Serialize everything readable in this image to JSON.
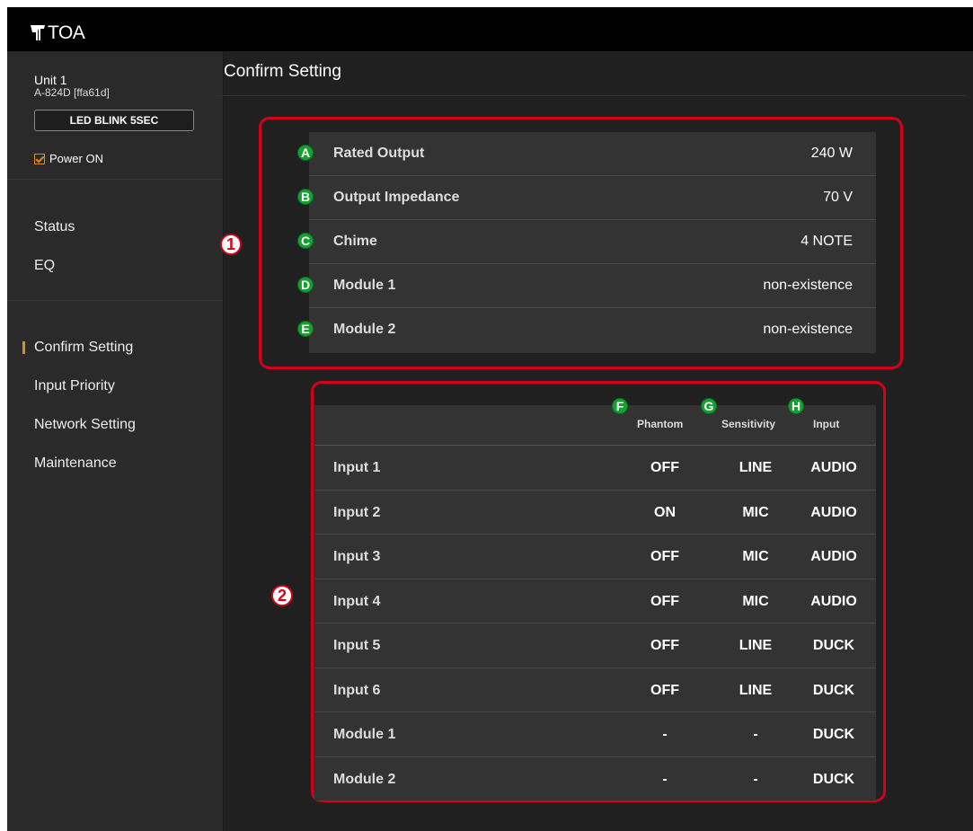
{
  "header": {
    "logo_text": "TOA"
  },
  "sidebar": {
    "unit_name": "Unit 1",
    "unit_model": "A-824D [ffa61d]",
    "led_button": "LED BLINK 5SEC",
    "power_label": "Power ON",
    "power_checked": true,
    "nav_group1": [
      "Status",
      "EQ"
    ],
    "nav_group2": [
      "Confirm Setting",
      "Input Priority",
      "Network Setting",
      "Maintenance"
    ],
    "active_item": "Confirm Setting"
  },
  "main": {
    "title": "Confirm Setting",
    "section1_badge": "1",
    "section2_badge": "2",
    "settings": [
      {
        "badge": "A",
        "label": "Rated Output",
        "value": "240 W"
      },
      {
        "badge": "B",
        "label": "Output Impedance",
        "value": "70 V"
      },
      {
        "badge": "C",
        "label": "Chime",
        "value": "4 NOTE"
      },
      {
        "badge": "D",
        "label": "Module 1",
        "value": "non-existence"
      },
      {
        "badge": "E",
        "label": "Module 2",
        "value": "non-existence"
      }
    ],
    "inputs_table": {
      "headers": [
        {
          "badge": "F",
          "label": "Phantom"
        },
        {
          "badge": "G",
          "label": "Sensitivity"
        },
        {
          "badge": "H",
          "label": "Input"
        }
      ],
      "rows": [
        {
          "name": "Input 1",
          "phantom": "OFF",
          "sensitivity": "LINE",
          "input": "AUDIO"
        },
        {
          "name": "Input 2",
          "phantom": "ON",
          "sensitivity": "MIC",
          "input": "AUDIO"
        },
        {
          "name": "Input 3",
          "phantom": "OFF",
          "sensitivity": "MIC",
          "input": "AUDIO"
        },
        {
          "name": "Input 4",
          "phantom": "OFF",
          "sensitivity": "MIC",
          "input": "AUDIO"
        },
        {
          "name": "Input 5",
          "phantom": "OFF",
          "sensitivity": "LINE",
          "input": "DUCK"
        },
        {
          "name": "Input 6",
          "phantom": "OFF",
          "sensitivity": "LINE",
          "input": "DUCK"
        },
        {
          "name": "Module 1",
          "phantom": "-",
          "sensitivity": "-",
          "input": "DUCK"
        },
        {
          "name": "Module 2",
          "phantom": "-",
          "sensitivity": "-",
          "input": "DUCK"
        }
      ]
    }
  },
  "colors": {
    "accent": "#e08a1e",
    "callout_red": "#d4001a",
    "callout_green": "#15a033"
  }
}
